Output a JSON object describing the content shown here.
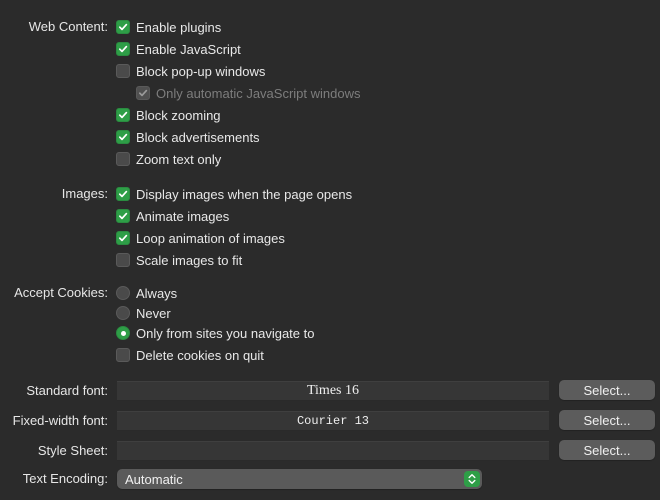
{
  "web_content": {
    "label": "Web Content:",
    "options": [
      {
        "label": "Enable plugins",
        "checked": true,
        "enabled": true
      },
      {
        "label": "Enable JavaScript",
        "checked": true,
        "enabled": true
      },
      {
        "label": "Block pop-up windows",
        "checked": false,
        "enabled": true
      },
      {
        "label": "Only automatic JavaScript windows",
        "checked": true,
        "enabled": false
      },
      {
        "label": "Block zooming",
        "checked": true,
        "enabled": true
      },
      {
        "label": "Block advertisements",
        "checked": true,
        "enabled": true
      },
      {
        "label": "Zoom text only",
        "checked": false,
        "enabled": true
      }
    ]
  },
  "images": {
    "label": "Images:",
    "options": [
      {
        "label": "Display images when the page opens",
        "checked": true
      },
      {
        "label": "Animate images",
        "checked": true
      },
      {
        "label": "Loop animation of images",
        "checked": true
      },
      {
        "label": "Scale images to fit",
        "checked": false
      }
    ]
  },
  "cookies": {
    "label": "Accept Cookies:",
    "radios": [
      {
        "label": "Always",
        "selected": false
      },
      {
        "label": "Never",
        "selected": false
      },
      {
        "label": "Only from sites you navigate to",
        "selected": true
      }
    ],
    "delete_on_quit": {
      "label": "Delete cookies on quit",
      "checked": false
    }
  },
  "fonts": {
    "standard": {
      "label": "Standard font:",
      "value": "Times 16",
      "button": "Select..."
    },
    "fixed": {
      "label": "Fixed-width font:",
      "value": "Courier 13",
      "button": "Select..."
    },
    "stylesheet": {
      "label": "Style Sheet:",
      "value": "",
      "button": "Select..."
    }
  },
  "encoding": {
    "label": "Text Encoding:",
    "value": "Automatic"
  },
  "colors": {
    "background": "#2b2b2b",
    "accent": "#2e9e47"
  }
}
